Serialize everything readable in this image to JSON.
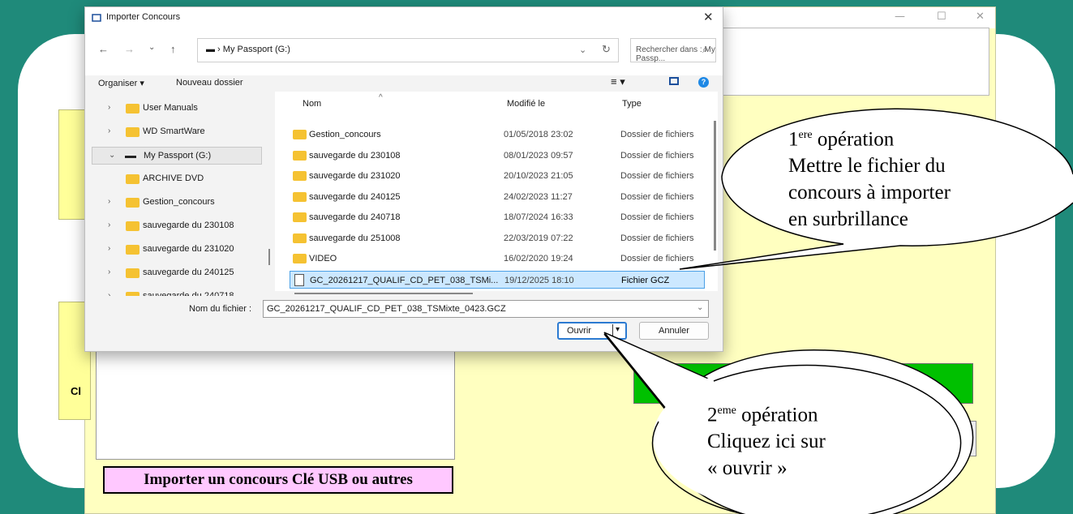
{
  "dialog": {
    "title": "Importer Concours",
    "address_path": "▬ › My Passport (G:)",
    "search_placeholder": "Rechercher dans : My Passp...",
    "toolbar": {
      "organize": "Organiser ▾",
      "new_folder": "Nouveau dossier"
    },
    "sidebar": [
      {
        "label": "User Manuals",
        "type": "folder",
        "expand": "›"
      },
      {
        "label": "WD SmartWare",
        "type": "folder",
        "expand": "›"
      },
      {
        "label": "My Passport (G:)",
        "type": "drive",
        "expand": "⌄",
        "selected": true
      },
      {
        "label": "ARCHIVE DVD",
        "type": "folder",
        "expand": ""
      },
      {
        "label": "Gestion_concours",
        "type": "folder",
        "expand": "›"
      },
      {
        "label": "sauvegarde du 230108",
        "type": "folder",
        "expand": "›"
      },
      {
        "label": "sauvegarde du 231020",
        "type": "folder",
        "expand": "›"
      },
      {
        "label": "sauvegarde du 240125",
        "type": "folder",
        "expand": "›"
      },
      {
        "label": "sauvegarde du 240718",
        "type": "folder",
        "expand": "›"
      }
    ],
    "columns": {
      "name": "Nom",
      "modified": "Modifié le",
      "type": "Type"
    },
    "files": [
      {
        "name": "Gestion_concours",
        "modified": "01/05/2018 23:02",
        "type": "Dossier de fichiers",
        "kind": "folder"
      },
      {
        "name": "sauvegarde du 230108",
        "modified": "08/01/2023 09:57",
        "type": "Dossier de fichiers",
        "kind": "folder"
      },
      {
        "name": "sauvegarde du 231020",
        "modified": "20/10/2023 21:05",
        "type": "Dossier de fichiers",
        "kind": "folder"
      },
      {
        "name": "sauvegarde du 240125",
        "modified": "24/02/2023 11:27",
        "type": "Dossier de fichiers",
        "kind": "folder"
      },
      {
        "name": "sauvegarde du 240718",
        "modified": "18/07/2024 16:33",
        "type": "Dossier de fichiers",
        "kind": "folder"
      },
      {
        "name": "sauvegarde du 251008",
        "modified": "22/03/2019 07:22",
        "type": "Dossier de fichiers",
        "kind": "folder"
      },
      {
        "name": "VIDEO",
        "modified": "16/02/2020 19:24",
        "type": "Dossier de fichiers",
        "kind": "folder"
      },
      {
        "name": "GC_20261217_QUALIF_CD_PET_038_TSMi...",
        "modified": "19/12/2025 18:10",
        "type": "Fichier GCZ",
        "kind": "file",
        "selected": true
      }
    ],
    "filename_label": "Nom du fichier :",
    "filename_value": "GC_20261217_QUALIF_CD_PET_038_TSMixte_0423.GCZ",
    "open_label": "Ouvrir",
    "cancel_label": "Annuler"
  },
  "app": {
    "truncated_label": "Cl",
    "import_button": "Importer un concours Clé USB ou autres"
  },
  "callouts": {
    "first": {
      "num": "1",
      "sup": "ere",
      "word": " opération",
      "lines": [
        "Mettre le fichier du",
        "concours à importer",
        "en surbrillance"
      ]
    },
    "second": {
      "num": "2",
      "sup": "eme",
      "word": " opération",
      "lines": [
        "Cliquez ici sur",
        "« ouvrir »"
      ]
    }
  },
  "colors": {
    "teal": "#1f8a7a",
    "app_bg": "#ffffc0",
    "green": "#00c000",
    "pink": "#ffc8ff",
    "selection": "#cce8ff"
  }
}
